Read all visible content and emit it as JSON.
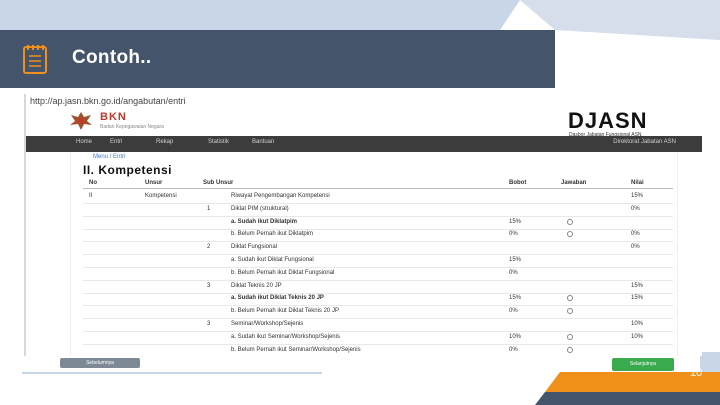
{
  "slide": {
    "title": "Contoh..",
    "page_number": "10",
    "colors": {
      "header_bg": "#44546a",
      "accent_orange": "#f0901a",
      "accent_blue_light": "#c9d6e8"
    }
  },
  "screenshot": {
    "url": "http://ap.jasn.bkn.go.id/angabutan/entri",
    "brand": {
      "logo_text": "BKN",
      "logo_subtext": "Badan Kepegawaian Negara",
      "app_name": "DJASN",
      "app_subtext": "Dasbor Jabatan Fungsional ASN"
    },
    "nav": {
      "items": [
        "Home",
        "Entri",
        "Rekap",
        "Statistik",
        "Bantuan"
      ],
      "user": "Direktorat Jabatan ASN"
    },
    "breadcrumb": "Menu / Entri",
    "section_title": "II. Kompetensi",
    "table": {
      "headers": [
        "No",
        "Unsur",
        "Sub Unsur",
        "Bobot",
        "Jawaban",
        "Nilai"
      ],
      "rows": [
        {
          "no": "II",
          "unsur": "Kompetensi",
          "sub_no": "",
          "sub": "Riwayat Pengembangan Kompetensi",
          "bobot": "",
          "radio": false,
          "nilai": "15%",
          "bold": false
        },
        {
          "no": "",
          "unsur": "",
          "sub_no": "1",
          "sub": "Diklat PIM (struktural)",
          "bobot": "",
          "radio": false,
          "nilai": "0%",
          "bold": false
        },
        {
          "no": "",
          "unsur": "",
          "sub_no": "",
          "sub": "a. Sudah ikut Diklatpim",
          "bobot": "15%",
          "radio": true,
          "nilai": "",
          "bold": true
        },
        {
          "no": "",
          "unsur": "",
          "sub_no": "",
          "sub": "b. Belum Pernah ikut Diklatpim",
          "bobot": "0%",
          "radio": true,
          "nilai": "0%",
          "bold": false
        },
        {
          "no": "",
          "unsur": "",
          "sub_no": "2",
          "sub": "Diklat Fungsional",
          "bobot": "",
          "radio": false,
          "nilai": "0%",
          "bold": false
        },
        {
          "no": "",
          "unsur": "",
          "sub_no": "",
          "sub": "a. Sudah ikut Diklat Fungsional",
          "bobot": "15%",
          "radio": false,
          "nilai": "",
          "bold": false
        },
        {
          "no": "",
          "unsur": "",
          "sub_no": "",
          "sub": "b. Belum Pernah ikut Diklat Fungsional",
          "bobot": "0%",
          "radio": false,
          "nilai": "",
          "bold": false
        },
        {
          "no": "",
          "unsur": "",
          "sub_no": "3",
          "sub": "Diklat Teknis 20 JP",
          "bobot": "",
          "radio": false,
          "nilai": "15%",
          "bold": false
        },
        {
          "no": "",
          "unsur": "",
          "sub_no": "",
          "sub": "a. Sudah ikut Diklat Teknis 20 JP",
          "bobot": "15%",
          "radio": true,
          "nilai": "15%",
          "bold": true
        },
        {
          "no": "",
          "unsur": "",
          "sub_no": "",
          "sub": "b. Belum Pernah ikut Diklat Teknis 20 JP",
          "bobot": "0%",
          "radio": true,
          "nilai": "",
          "bold": false
        },
        {
          "no": "",
          "unsur": "",
          "sub_no": "3",
          "sub": "Seminar/Workshop/Sejenis",
          "bobot": "",
          "radio": false,
          "nilai": "10%",
          "bold": false
        },
        {
          "no": "",
          "unsur": "",
          "sub_no": "",
          "sub": "a. Sudah ikut Seminar/Workshop/Sejenis",
          "bobot": "10%",
          "radio": true,
          "nilai": "10%",
          "bold": false
        },
        {
          "no": "",
          "unsur": "",
          "sub_no": "",
          "sub": "b. Belum Pernah ikut Seminar/Workshop/Sejenis",
          "bobot": "0%",
          "radio": true,
          "nilai": "",
          "bold": false
        }
      ]
    },
    "buttons": {
      "back": "Sebelumnya",
      "next": "Selanjutnya"
    }
  }
}
